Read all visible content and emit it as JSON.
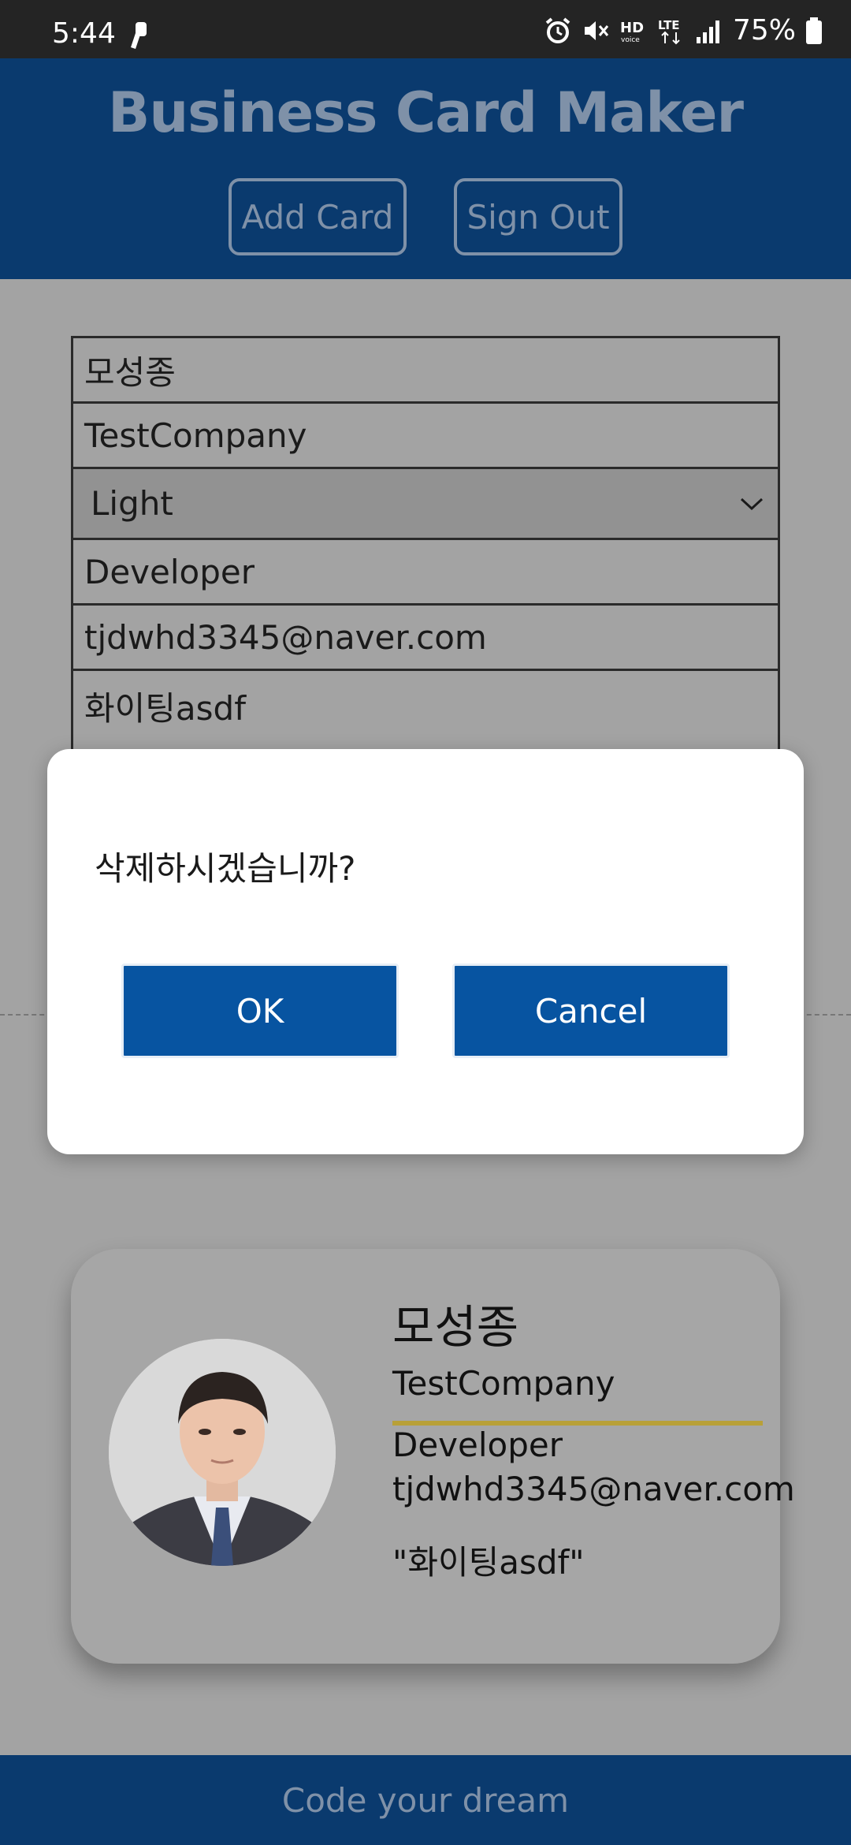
{
  "status_bar": {
    "time": "5:44",
    "battery": "75%",
    "icons": [
      "vpn-key-icon",
      "alarm-icon",
      "mute-icon",
      "hd-voice-icon",
      "lte-icon",
      "signal-icon",
      "battery-icon"
    ]
  },
  "header": {
    "title": "Business Card Maker",
    "add_card": "Add Card",
    "sign_out": "Sign Out"
  },
  "form": {
    "name": "모성종",
    "company": "TestCompany",
    "theme": "Light",
    "title": "Developer",
    "email": "tjdwhd3345@naver.com",
    "message": "화이팅asdf"
  },
  "dialog": {
    "message": "삭제하시겠습니까?",
    "ok": "OK",
    "cancel": "Cancel"
  },
  "card": {
    "name": "모성종",
    "company": "TestCompany",
    "title": "Developer",
    "email": "tjdwhd3345@naver.com",
    "message": "\"화이팅asdf\""
  },
  "footer": {
    "text": "Code your dream"
  },
  "colors": {
    "header_bg": "#0a3a6e",
    "header_text": "#7f91a8",
    "dialog_button": "#0754a1",
    "card_accent": "#b8a038",
    "overlay_bg": "#a3a3a3"
  }
}
